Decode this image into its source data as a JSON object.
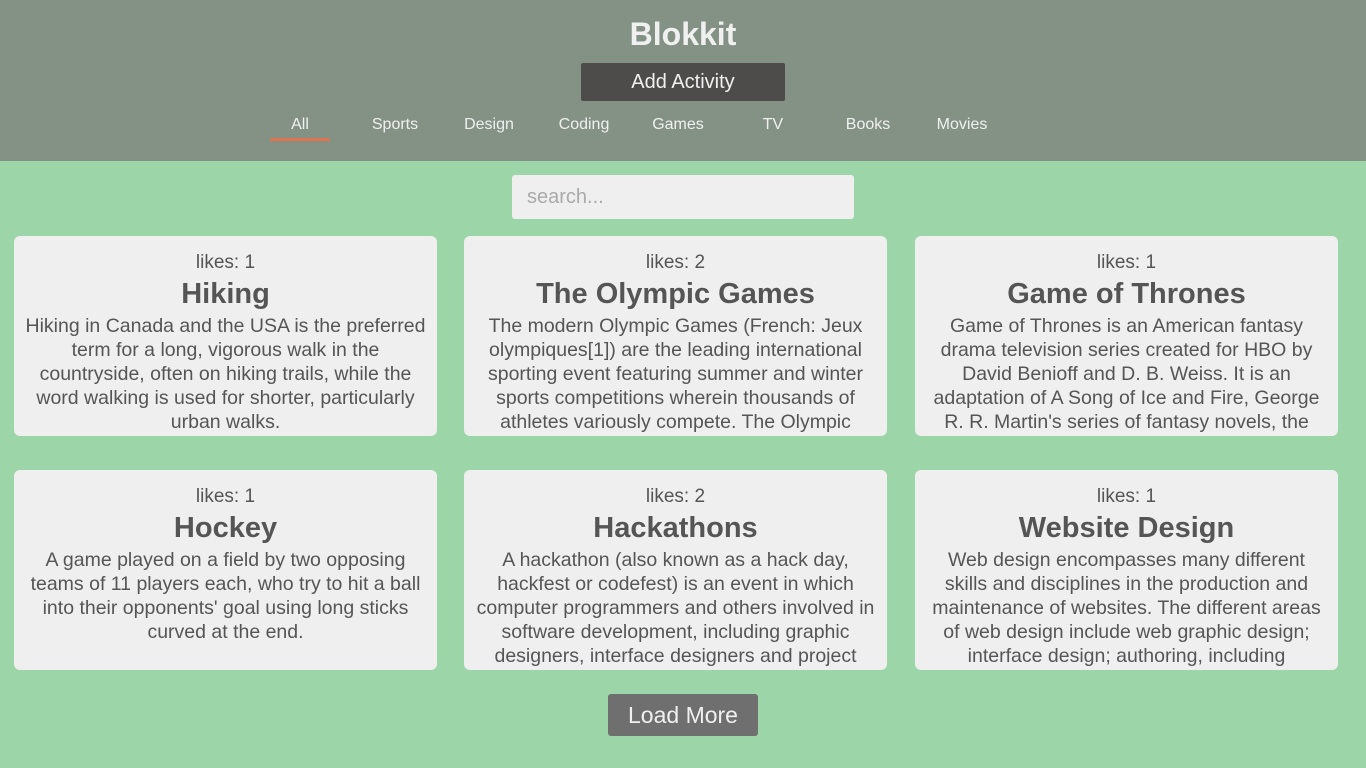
{
  "header": {
    "title": "Blokkit",
    "add_label": "Add Activity"
  },
  "tabs": [
    {
      "label": "All",
      "active": true
    },
    {
      "label": "Sports"
    },
    {
      "label": "Design"
    },
    {
      "label": "Coding"
    },
    {
      "label": "Games"
    },
    {
      "label": "TV"
    },
    {
      "label": "Books"
    },
    {
      "label": "Movies"
    }
  ],
  "search": {
    "placeholder": "search...",
    "value": ""
  },
  "cards": [
    {
      "likes": "likes: 1",
      "title": "Hiking",
      "desc": "Hiking in Canada and the USA is the preferred term for a long, vigorous walk in the countryside, often on hiking trails, while the word walking is used for shorter, particularly urban walks."
    },
    {
      "likes": "likes: 2",
      "title": "The Olympic Games",
      "desc": "The modern Olympic Games (French: Jeux olympiques[1]) are the leading international sporting event featuring summer and winter sports competitions wherein thousands of athletes variously compete. The Olympic"
    },
    {
      "likes": "likes: 1",
      "title": "Game of Thrones",
      "desc": "Game of Thrones is an American fantasy drama television series created for HBO by David Benioff and D. B. Weiss. It is an adaptation of A Song of Ice and Fire, George R. R. Martin's series of fantasy novels, the"
    },
    {
      "likes": "likes: 1",
      "title": "Hockey",
      "desc": "A game played on a field by two opposing teams of 11 players each, who try to hit a ball into their opponents' goal using long sticks curved at the end."
    },
    {
      "likes": "likes: 2",
      "title": "Hackathons",
      "desc": "A hackathon (also known as a hack day, hackfest or codefest) is an event in which computer programmers and others involved in software development, including graphic designers, interface designers and project"
    },
    {
      "likes": "likes: 1",
      "title": "Website Design",
      "desc": "Web design encompasses many different skills and disciplines in the production and maintenance of websites. The different areas of web design include web graphic design; interface design; authoring, including"
    }
  ],
  "load_more_label": "Load More",
  "colors": {
    "header_bg": "#849285",
    "page_bg": "#9cd6a8",
    "card_bg": "#efefef",
    "accent": "#e0734c",
    "add_button_bg": "#4e4c4b",
    "load_more_bg": "#6f6f6f"
  }
}
